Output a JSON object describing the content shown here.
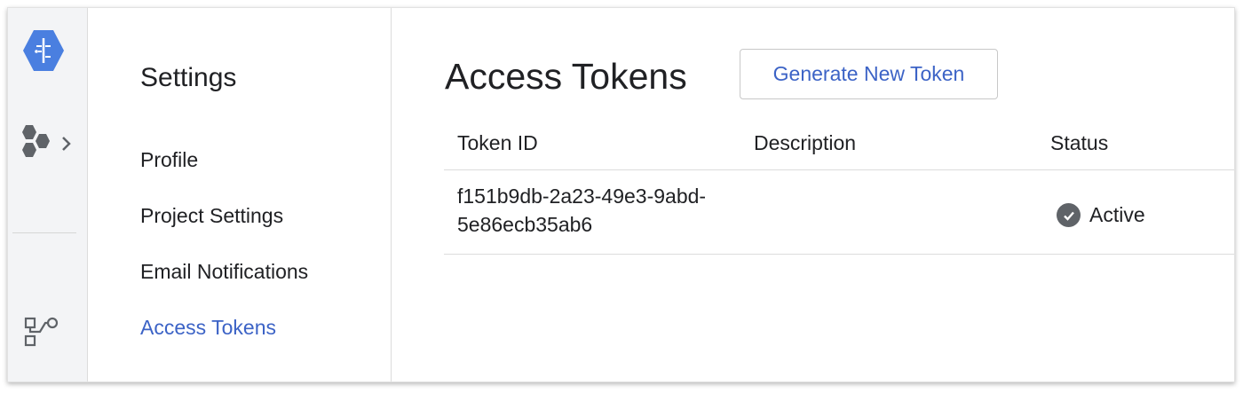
{
  "rail": {
    "icons": [
      "hexagon-logo-icon",
      "hexagon-cluster-icon",
      "chevron-right-icon",
      "workflow-icon"
    ]
  },
  "nav": {
    "title": "Settings",
    "items": [
      {
        "label": "Profile",
        "active": false
      },
      {
        "label": "Project Settings",
        "active": false
      },
      {
        "label": "Email Notifications",
        "active": false
      },
      {
        "label": "Access Tokens",
        "active": true
      }
    ]
  },
  "main": {
    "title": "Access Tokens",
    "generate_button": "Generate New Token",
    "table": {
      "columns": [
        "Token ID",
        "Description",
        "Status"
      ],
      "rows": [
        {
          "token_id_line1": "f151b9db-2a23-49e3-9abd-",
          "token_id_line2": "5e86ecb35ab6",
          "description": "",
          "status": "Active"
        }
      ]
    }
  },
  "colors": {
    "accent": "#3c63c6",
    "logo": "#4a7fe0",
    "rail_bg": "#f3f4f6",
    "status_icon": "#5f6368"
  }
}
